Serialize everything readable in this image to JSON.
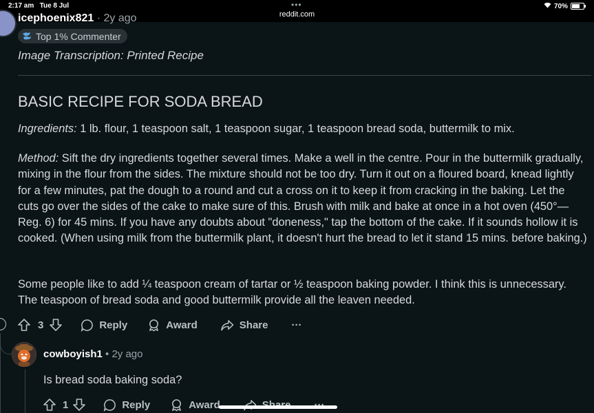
{
  "status_bar": {
    "time": "2:17 am",
    "date": "Tue 8 Jul",
    "url": "reddit.com",
    "battery": "70%"
  },
  "top_comment": {
    "username": "icephoenix821",
    "age": "2y ago",
    "badge": "Top 1% Commenter",
    "transcription_title": "Image Transcription: Printed Recipe",
    "heading": "BASIC RECIPE FOR SODA BREAD",
    "ingredients_label": "Ingredients:",
    "ingredients_text": " 1 lb. flour, 1 teaspoon salt, 1 teaspoon sugar, 1 teaspoon bread soda, buttermilk to mix.",
    "method_label": "Method:",
    "method_text": " Sift the dry ingredients together several times. Make a well in the centre. Pour in the buttermilk gradually, mixing in the flour from the sides. The mixture should not be too dry. Turn it out on a floured board, knead lightly for a few minutes, pat the dough to a round and cut a cross on it to keep it from cracking in the baking. Let the cuts go over the sides of the cake to make sure of this. Brush with milk and bake at once in a hot oven (450°—Reg. 6) for 45 mins. If you have any doubts about \"doneness,\" tap the bottom of the cake. If it sounds hollow it is cooked. (When using milk from the buttermilk plant, it doesn't hurt the bread to let it stand 15 mins. before baking.)",
    "note_text": "Some people like to add ¼ teaspoon cream of tartar or ½ teaspoon baking powder. I think this is unnecessary. The teaspoon of bread soda and good buttermilk provide all the leaven needed.",
    "actions": {
      "score": "3",
      "reply": "Reply",
      "award": "Award",
      "share": "Share",
      "more": "···"
    }
  },
  "reply_comment": {
    "username": "cowboyish1",
    "separator": " • ",
    "age": "2y ago",
    "text": "Is bread soda baking soda?",
    "actions": {
      "score": "1",
      "reply": "Reply",
      "award": "Award",
      "share": "Share",
      "more": "···"
    }
  },
  "colors": {
    "background": "#0b1416",
    "text": "#d7dadc",
    "muted": "#b8c0c3",
    "badge_bg": "#2a3236"
  }
}
